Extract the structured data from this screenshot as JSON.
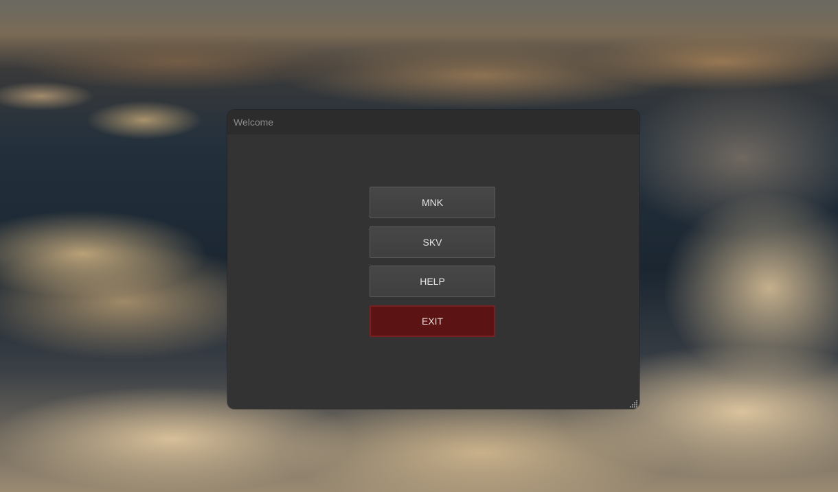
{
  "window": {
    "title": "Welcome"
  },
  "buttons": {
    "mnk": "MNK",
    "skv": "SKV",
    "help": "HELP",
    "exit": "EXIT"
  },
  "colors": {
    "window_bg": "#333333",
    "titlebar_bg": "#2c2c2c",
    "button_bg": "#444444",
    "exit_bg": "#5c1313"
  },
  "icons": {
    "resize_grip": "resize-grip-icon"
  }
}
